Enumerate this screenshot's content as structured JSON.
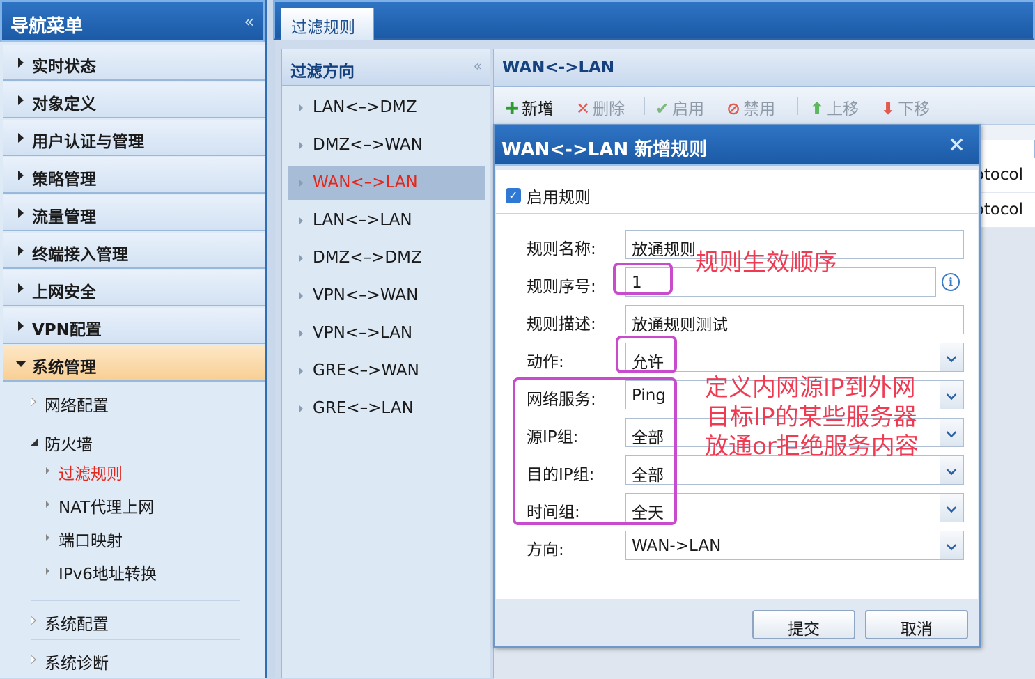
{
  "nav": {
    "title": "导航菜单",
    "collapse": "«",
    "items": [
      {
        "label": "实时状态"
      },
      {
        "label": "对象定义"
      },
      {
        "label": "用户认证与管理"
      },
      {
        "label": "策略管理"
      },
      {
        "label": "流量管理"
      },
      {
        "label": "终端接入管理"
      },
      {
        "label": "上网安全"
      },
      {
        "label": "VPN配置"
      },
      {
        "label": "系统管理"
      }
    ],
    "sub": {
      "network": "网络配置",
      "firewall": "防火墙",
      "firewall_children": [
        "过滤规则",
        "NAT代理上网",
        "端口映射",
        "IPv6地址转换"
      ],
      "system_config": "系统配置",
      "system_diag": "系统诊断"
    }
  },
  "tab": {
    "label": "过滤规则"
  },
  "direction": {
    "title": "过滤方向",
    "collapse": "«",
    "items": [
      "LAN<–>DMZ",
      "DMZ<–>WAN",
      "WAN<–>LAN",
      "LAN<–>LAN",
      "DMZ<–>DMZ",
      "VPN<–>WAN",
      "VPN<–>LAN",
      "GRE<–>WAN",
      "GRE<–>LAN"
    ],
    "selected": "WAN<–>LAN"
  },
  "rule_panel": {
    "title": "WAN<->LAN",
    "toolbar": {
      "add": "新增",
      "delete": "删除",
      "enable": "启用",
      "disable": "禁用",
      "up": "上移",
      "down": "下移"
    },
    "rows": [
      "otocol",
      "otocol"
    ]
  },
  "dialog": {
    "title": "WAN<->LAN 新增规则",
    "close": "×",
    "enable_label": "启用规则",
    "fields": {
      "name_label": "规则名称:",
      "name_value": "放通规则",
      "seq_label": "规则序号:",
      "seq_value": "1",
      "desc_label": "规则描述:",
      "desc_value": "放通规则测试",
      "action_label": "动作:",
      "action_value": "允许",
      "service_label": "网络服务:",
      "service_value": "Ping",
      "src_label": "源IP组:",
      "src_value": "全部",
      "dst_label": "目的IP组:",
      "dst_value": "全部",
      "time_label": "时间组:",
      "time_value": "全天",
      "dir_label": "方向:",
      "dir_value": "WAN->LAN"
    },
    "info_icon": "i",
    "submit": "提交",
    "cancel": "取消"
  },
  "annotations": {
    "order": "规则生效顺序",
    "services": [
      "定义内网源IP到外网",
      "目标IP的某些服务器",
      "放通or拒绝服务内容"
    ]
  },
  "colors": {
    "accent": "#1b5aa6",
    "active_text": "#e3271c",
    "annotation": "#ef3a52",
    "annotation_box": "#c94bcd"
  }
}
